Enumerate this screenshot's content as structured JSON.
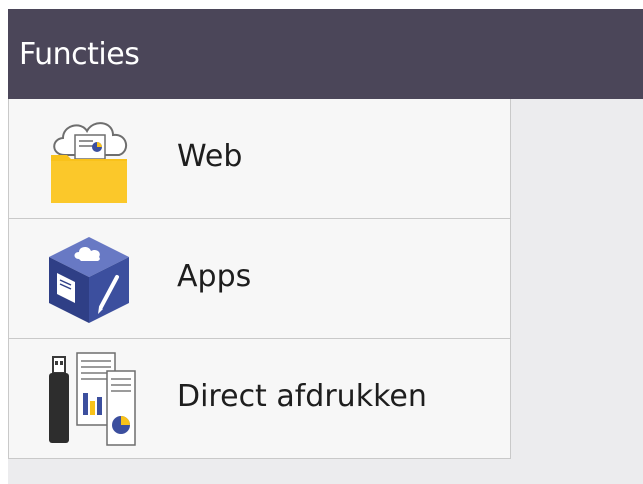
{
  "header": {
    "title": "Functies"
  },
  "menu": {
    "items": [
      {
        "label": "Web",
        "icon": "cloud-folder-icon"
      },
      {
        "label": "Apps",
        "icon": "apps-cube-icon"
      },
      {
        "label": "Direct afdrukken",
        "icon": "usb-print-icon"
      }
    ]
  },
  "colors": {
    "header_bg": "#4b4659",
    "panel_bg": "#ececee",
    "item_bg": "#f7f7f7",
    "folder_yellow": "#f9c21a",
    "cube_blue": "#3c4f9e"
  }
}
